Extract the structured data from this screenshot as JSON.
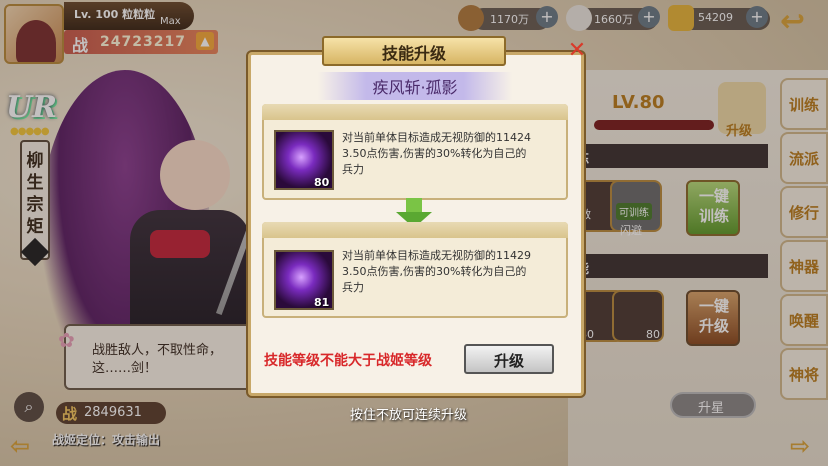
{
  "profile": {
    "level": "Lv. 100",
    "player_name": "粒粒粒",
    "max_label": "Max",
    "power_label": "战",
    "power_value": "24723217"
  },
  "character": {
    "rarity": "UR",
    "name": "柳生宗矩",
    "stars": "●●●●●",
    "dialogue": "战胜敌人，不取性命，这……剑！",
    "battle_power_label": "战",
    "battle_power": "2849631",
    "position": "战姬定位：攻击输出"
  },
  "currencies": [
    {
      "name": "copper",
      "value": "1170万",
      "color": "#b07a3c"
    },
    {
      "name": "rice",
      "value": "1660万",
      "color": "#ebe7e0"
    },
    {
      "name": "gold",
      "value": "54209",
      "color": "#e7b53a"
    }
  ],
  "right_panel": {
    "level": "LV.80",
    "upgrade_label": "升级",
    "section1": "练",
    "section2": "能",
    "tag_trainable": "可训练",
    "dodge": "闪避",
    "slot1": "敏",
    "one_click_train": "一键训练",
    "one_click_upgrade": "一键升级",
    "slot_lv_a": "80",
    "slot_lv_b": "80",
    "star_up": "升星"
  },
  "side_tabs": [
    "训练",
    "流派",
    "修行",
    "神器",
    "唤醒",
    "神将"
  ],
  "modal": {
    "title": "技能升级",
    "skill_name": "疾风斩·孤影",
    "current": {
      "level": "80",
      "desc_line1": "对当前单体目标造成无视防御的11424",
      "desc_line2": "3.50点伤害,伤害的30%转化为自己的",
      "desc_line3": "兵力"
    },
    "next": {
      "level": "81",
      "desc_line1": "对当前单体目标造成无视防御的11429",
      "desc_line2": "3.50点伤害,伤害的30%转化为自己的",
      "desc_line3": "兵力"
    },
    "warning": "技能等级不能大于战姬等级",
    "upgrade_button": "升级",
    "close": "✕"
  },
  "hint": "按住不放可连续升级"
}
